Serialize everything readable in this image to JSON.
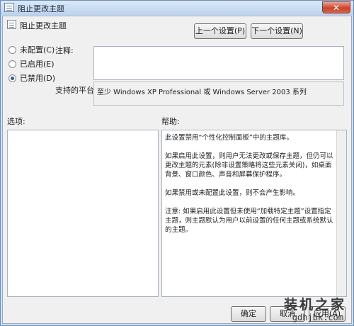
{
  "window": {
    "title": "阻止更改主题",
    "close_glyph": "✕"
  },
  "header": {
    "title": "阻止更改主题",
    "prev_button": "上一个设置(P)",
    "next_button": "下一个设置(N)"
  },
  "state": {
    "options": [
      {
        "label": "未配置(C)",
        "checked": false
      },
      {
        "label": "已启用(E)",
        "checked": false
      },
      {
        "label": "已禁用(D)",
        "checked": true
      }
    ]
  },
  "comment": {
    "label": "注释:",
    "value": ""
  },
  "platform": {
    "label": "支持的平台:",
    "value": "至少 Windows XP Professional 或 Windows Server 2003 系列"
  },
  "options_pane": {
    "label": "选项:"
  },
  "help_pane": {
    "label": "帮助:",
    "paragraphs": [
      "此设置禁用“个性化控制面板”中的主题库。",
      "如果启用此设置，则用户无法更改或保存主题，但仍可以更改主题的元素(除非设置策略将这些元素关闭)，如桌面背景、窗口颜色、声音和屏幕保护程序。",
      "如果禁用或未配置此设置，则不会产生影响。",
      "注意: 如果启用此设置但未使用“加载特定主题”设置指定主题，则主题默认为用户以前设置的任何主题或系统默认的主题。"
    ]
  },
  "footer": {
    "ok": "确定",
    "cancel": "取消",
    "apply": "应用(A)"
  },
  "watermark": {
    "text": "装机之家",
    "url": "gdhjbk.com"
  },
  "colors": {
    "title_bar": "#cfe0f2",
    "accent": "#2a5a9c",
    "close": "#c8452f"
  }
}
